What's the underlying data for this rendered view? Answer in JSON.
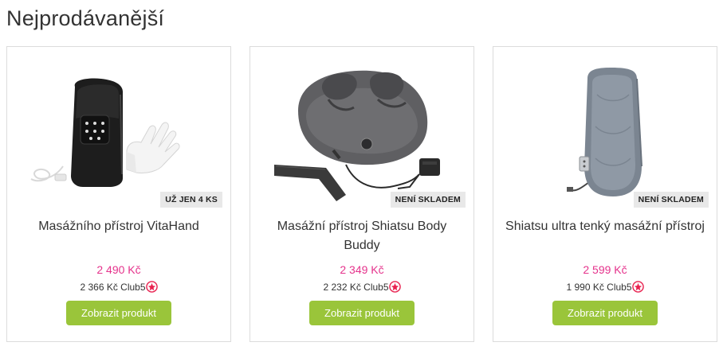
{
  "section": {
    "title": "Nejprodávanější"
  },
  "products": [
    {
      "badge": "UŽ JEN 4 KS",
      "name": "Masážního přístroj VitaHand",
      "price": "2 490 Kč",
      "club_price": "2 366 Kč Club5",
      "button": "Zobrazit produkt",
      "image_icon": "hand-massager-image"
    },
    {
      "badge": "NENÍ SKLADEM",
      "name": "Masážní přístroj Shiatsu Body Buddy",
      "price": "2 349 Kč",
      "club_price": "2 232 Kč Club5",
      "button": "Zobrazit produkt",
      "image_icon": "neck-massager-image"
    },
    {
      "badge": "NENÍ SKLADEM",
      "name": "Shiatsu ultra tenký masážní přístroj",
      "price": "2 599 Kč",
      "club_price": "1 990 Kč Club5",
      "button": "Zobrazit produkt",
      "image_icon": "seat-massager-image"
    }
  ],
  "colors": {
    "price": "#e5338c",
    "button": "#9ac53a",
    "club_icon": "#e8204e"
  }
}
